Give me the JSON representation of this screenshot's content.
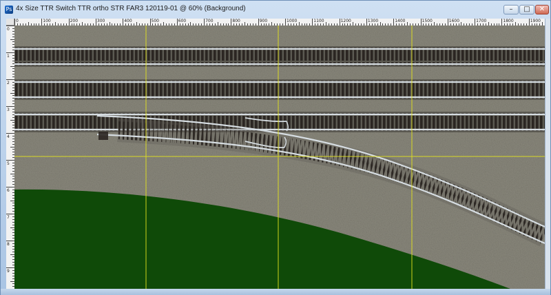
{
  "window": {
    "title": "4x Size TTR Switch TTR ortho STR FAR3 120119-01 @ 60% (Background)",
    "app_icon": "Ps",
    "controls": {
      "minimize": "–",
      "maximize": "□",
      "close": "✕"
    }
  },
  "rulers": {
    "top_labels": [
      "0",
      "100",
      "200",
      "300",
      "400",
      "500",
      "600",
      "700",
      "800",
      "900",
      "1000",
      "1100",
      "1200",
      "1300",
      "1400",
      "1500",
      "1600",
      "1700",
      "1800",
      "1900"
    ],
    "left_labels": [
      "0",
      "1",
      "2",
      "3",
      "4",
      "5",
      "6",
      "7",
      "8",
      "9"
    ]
  },
  "canvas": {
    "guide_color": "#e4e41c",
    "grass_color": "#0f4a08",
    "ballast_color": "#8a887c",
    "rail_color": "#d6dde2",
    "tie_color": "#2b2622"
  }
}
